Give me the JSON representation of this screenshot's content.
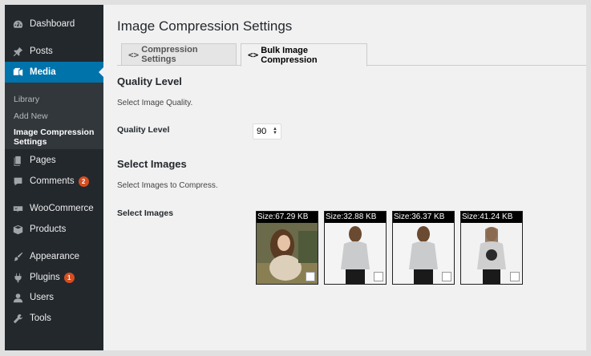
{
  "sidebar": {
    "items": [
      {
        "label": "Dashboard",
        "icon": "dashboard-icon"
      },
      {
        "label": "Posts",
        "icon": "pin-icon"
      },
      {
        "label": "Media",
        "icon": "media-icon"
      },
      {
        "label": "Pages",
        "icon": "pages-icon"
      },
      {
        "label": "Comments",
        "icon": "comment-icon",
        "badge": "2"
      },
      {
        "label": "WooCommerce",
        "icon": "woocommerce-icon"
      },
      {
        "label": "Products",
        "icon": "box-icon"
      },
      {
        "label": "Appearance",
        "icon": "brush-icon"
      },
      {
        "label": "Plugins",
        "icon": "plug-icon",
        "badge": "1"
      },
      {
        "label": "Users",
        "icon": "user-icon"
      },
      {
        "label": "Tools",
        "icon": "wrench-icon"
      }
    ],
    "media_submenu": [
      "Library",
      "Add New",
      "Image Compression Settings"
    ]
  },
  "page": {
    "title": "Image Compression Settings",
    "tabs": [
      {
        "label": "Compression Settings",
        "active": false
      },
      {
        "label": "Bulk Image Compression",
        "active": true
      }
    ]
  },
  "quality": {
    "section_title": "Quality Level",
    "description": "Select Image Quality.",
    "field_label": "Quality Level",
    "selected_value": "90"
  },
  "images": {
    "section_title": "Select Images",
    "description": "Select Images to Compress.",
    "field_label": "Select Images",
    "thumbnails": [
      {
        "size": "Size:67.29 KB",
        "checked": false
      },
      {
        "size": "Size:32.88 KB",
        "checked": false
      },
      {
        "size": "Size:36.37 KB",
        "checked": false
      },
      {
        "size": "Size:41.24 KB",
        "checked": false
      }
    ]
  },
  "colors": {
    "sidebar_bg": "#23282d",
    "submenu_bg": "#32373c",
    "accent": "#0073aa",
    "badge": "#d54e21",
    "content_bg": "#f1f1f1"
  }
}
